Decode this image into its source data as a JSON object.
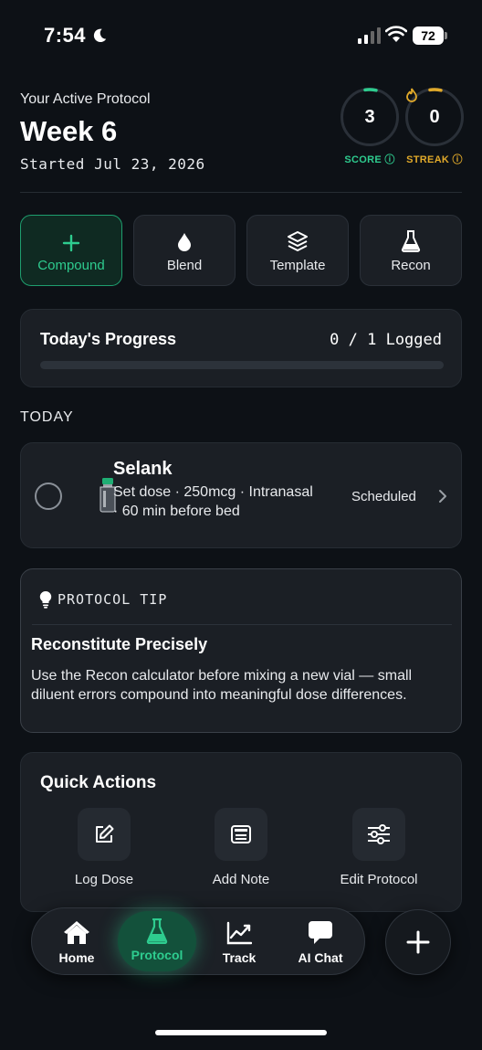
{
  "status_bar": {
    "time": "7:54",
    "battery": "72"
  },
  "header": {
    "label": "Your Active Protocol",
    "week": "Week 6",
    "started": "Started Jul 23, 2026",
    "score": {
      "value": "3",
      "label": "SCORE ⓘ",
      "color": "#2ecc8f"
    },
    "streak": {
      "value": "0",
      "label": "STREAK ⓘ",
      "color": "#e0a92a"
    }
  },
  "actions": [
    {
      "label": "Compound",
      "icon": "plus-icon"
    },
    {
      "label": "Blend",
      "icon": "drop-icon"
    },
    {
      "label": "Template",
      "icon": "layers-icon"
    },
    {
      "label": "Recon",
      "icon": "flask-icon"
    }
  ],
  "progress": {
    "title": "Today's Progress",
    "count": "0 / 1 Logged",
    "logged": 0,
    "total": 1
  },
  "today": {
    "heading": "TODAY",
    "dose": {
      "name": "Selank",
      "detail": "Set dose · 250mcg · Intranasal · 60 min before bed",
      "status": "Scheduled"
    }
  },
  "tip": {
    "heading": "PROTOCOL TIP",
    "title": "Reconstitute Precisely",
    "body": "Use the Recon calculator before mixing a new vial — small diluent errors compound into meaningful dose differences."
  },
  "quick_actions": {
    "title": "Quick Actions",
    "items": [
      {
        "label": "Log Dose",
        "icon": "edit-icon"
      },
      {
        "label": "Add Note",
        "icon": "note-icon"
      },
      {
        "label": "Edit Protocol",
        "icon": "sliders-icon"
      }
    ]
  },
  "tabs": [
    {
      "label": "Home",
      "icon": "home-icon"
    },
    {
      "label": "Protocol",
      "icon": "flask-icon",
      "active": true
    },
    {
      "label": "Track",
      "icon": "chart-icon"
    },
    {
      "label": "AI Chat",
      "icon": "chat-icon"
    }
  ],
  "colors": {
    "accent": "#2ecc8f",
    "streak": "#e0a92a",
    "background": "#0d1116",
    "card": "#1b1f25"
  }
}
